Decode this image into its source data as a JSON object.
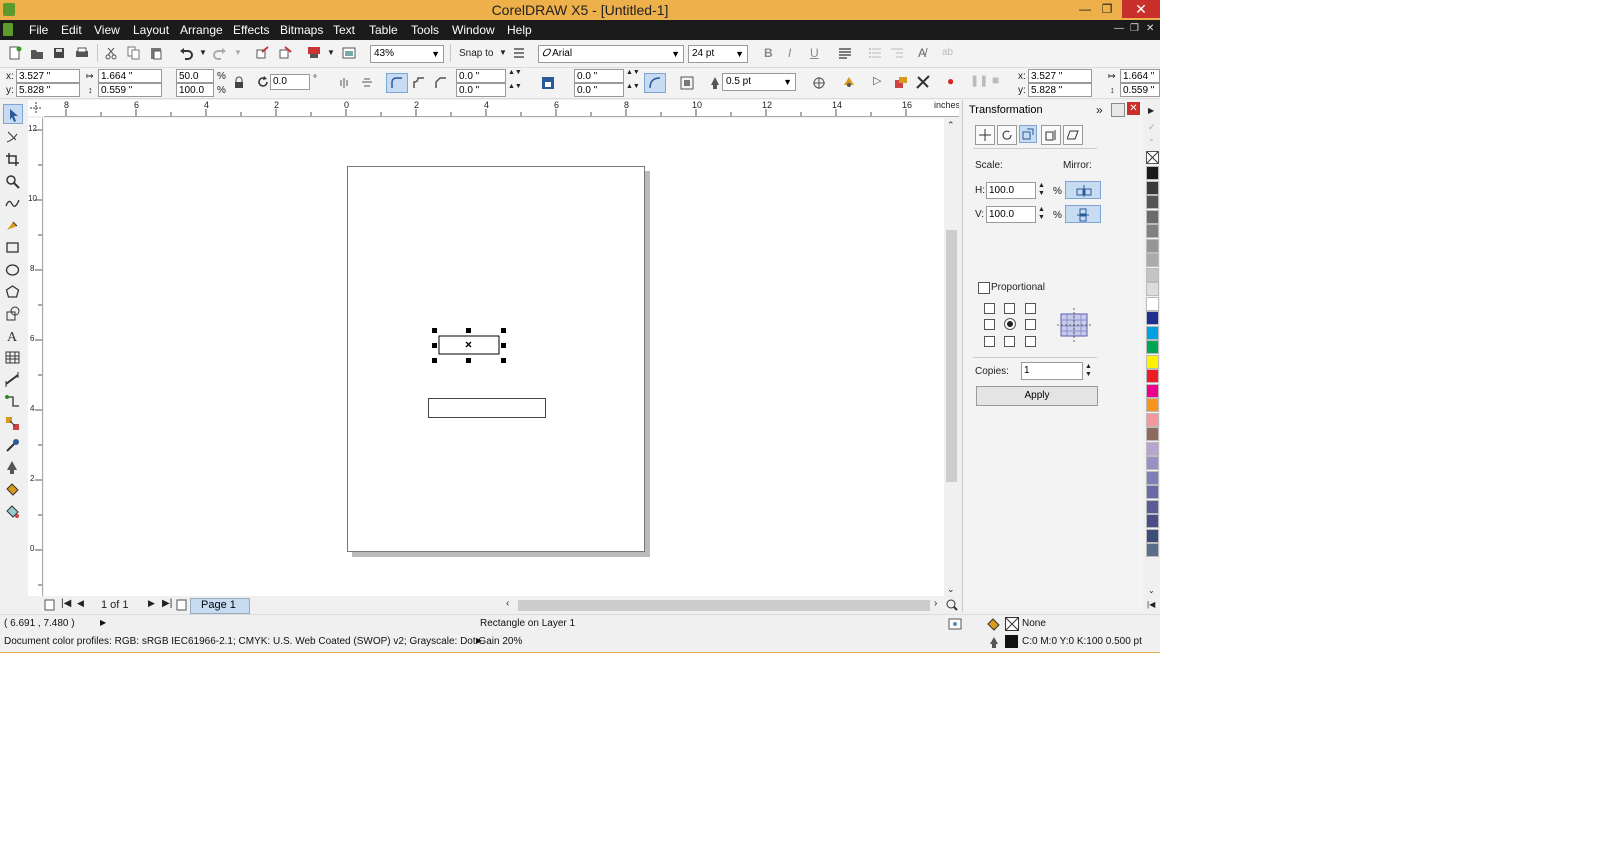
{
  "window": {
    "title": "CorelDRAW X5 - [Untitled-1]"
  },
  "menu": [
    "File",
    "Edit",
    "View",
    "Layout",
    "Arrange",
    "Effects",
    "Bitmaps",
    "Text",
    "Table",
    "Tools",
    "Window",
    "Help"
  ],
  "standard_bar": {
    "zoom": "43%",
    "snap_to": "Snap to",
    "font_name": "Arial",
    "font_size": "24 pt"
  },
  "property_bar": {
    "x_label": "x:",
    "x": "3.527 \"",
    "y_label": "y:",
    "y": "5.828 \"",
    "w": "1.664 \"",
    "h": "0.559 \"",
    "scale_w": "50.0",
    "scale_h": "100.0",
    "percent": "%",
    "angle": "0.0",
    "degree": "°",
    "corner1": "0.0 \"",
    "corner2": "0.0 \"",
    "corner3": "0.0 \"",
    "corner4": "0.0 \"",
    "outline_width": "0.5 pt",
    "x2": "3.527 \"",
    "y2": "5.828 \"",
    "w2": "1.664 \"",
    "h2": "0.559 \""
  },
  "rulers": {
    "units": "inches",
    "h_ticks": [
      "8",
      "6",
      "4",
      "2",
      "0",
      "2",
      "4",
      "6",
      "8",
      "10",
      "12",
      "14",
      "16"
    ],
    "v_ticks": [
      "12",
      "10",
      "8",
      "6",
      "4",
      "2",
      "0"
    ]
  },
  "page_nav": {
    "counter": "1 of 1",
    "tab": "Page 1"
  },
  "docker": {
    "title": "Transformation",
    "scale_label": "Scale:",
    "mirror_label": "Mirror:",
    "h_label": "H:",
    "h_value": "100.0",
    "v_label": "V:",
    "v_value": "100.0",
    "pct": "%",
    "proportional": "Proportional",
    "copies_label": "Copies:",
    "copies_value": "1",
    "apply": "Apply"
  },
  "palette": [
    "#1a1a1a",
    "#3a3a3a",
    "#555555",
    "#6b6b6b",
    "#808080",
    "#969696",
    "#ababab",
    "#c4c4c4",
    "#dcdcdc",
    "#ffffff",
    "#1f2f8f",
    "#00a0e3",
    "#00a651",
    "#fff200",
    "#ed1c24",
    "#ec008c",
    "#f7941d",
    "#f5989d",
    "#8c6b5a",
    "#b7a5d0",
    "#9b8fc4",
    "#7f7fb8",
    "#6a6aa8",
    "#5b5b98",
    "#4c4c88",
    "#3d4c78",
    "#5a6e8a"
  ],
  "status": {
    "coords": "( 6.691 , 7.480 )",
    "object": "Rectangle on Layer 1",
    "profiles": "Document color profiles: RGB: sRGB IEC61966-2.1; CMYK: U.S. Web Coated (SWOP) v2; Grayscale: Dot Gain 20%",
    "fill": "None",
    "outline": "C:0 M:0 Y:0 K:100  0.500 pt"
  }
}
